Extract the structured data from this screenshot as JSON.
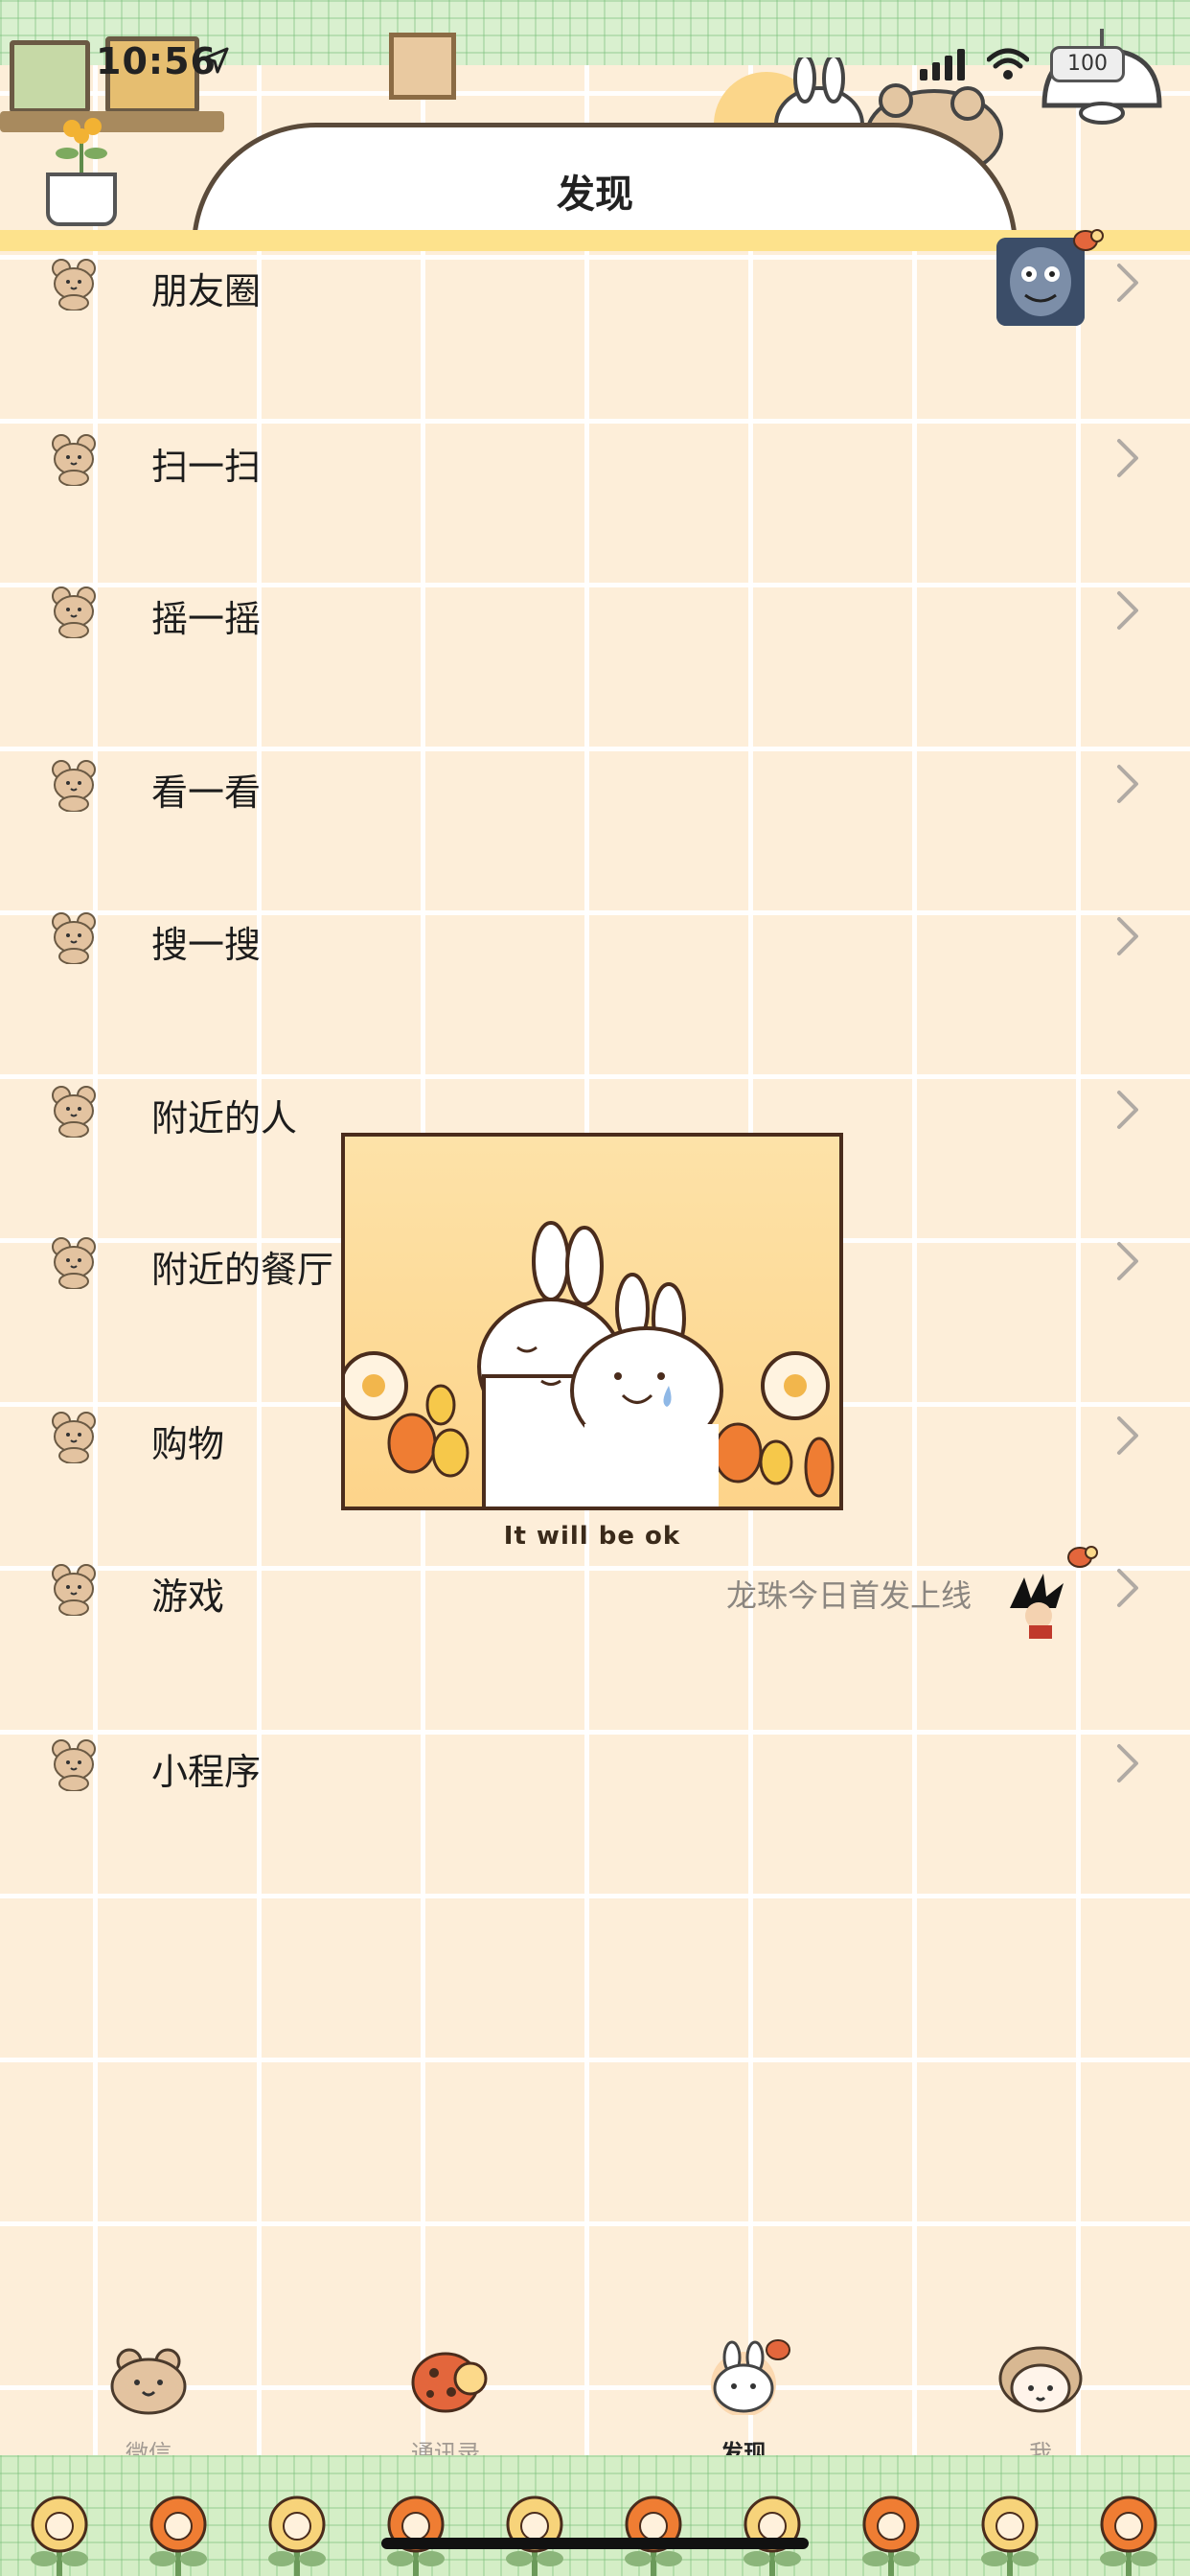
{
  "status_bar": {
    "time": "10:56",
    "battery": "100"
  },
  "nav": {
    "title": "发现"
  },
  "menu": [
    {
      "label": "朋友圈",
      "sub": "",
      "thumb": "moments-avatar"
    },
    {
      "label": "扫一扫",
      "sub": ""
    },
    {
      "label": "摇一摇",
      "sub": ""
    },
    {
      "label": "看一看",
      "sub": ""
    },
    {
      "label": "搜一搜",
      "sub": ""
    },
    {
      "label": "附近的人",
      "sub": ""
    },
    {
      "label": "附近的餐厅",
      "sub": ""
    },
    {
      "label": "购物",
      "sub": ""
    },
    {
      "label": "游戏",
      "sub": "龙珠今日首发上线",
      "thumb": "game-character"
    },
    {
      "label": "小程序",
      "sub": ""
    }
  ],
  "sticker": {
    "caption": "It will be ok"
  },
  "tabs": [
    {
      "label": "微信",
      "icon": "bear-face-icon",
      "active": false
    },
    {
      "label": "通讯录",
      "icon": "ladybug-icon",
      "active": false
    },
    {
      "label": "发现",
      "icon": "bunny-face-icon",
      "active": true
    },
    {
      "label": "我",
      "icon": "girl-face-icon",
      "active": false
    }
  ],
  "colors": {
    "background": "#fdeed9",
    "accent_bar": "#fde28c",
    "grid_green": "#d9f0cf",
    "chevron": "#b0aaa4",
    "subtext": "#8b8680"
  }
}
